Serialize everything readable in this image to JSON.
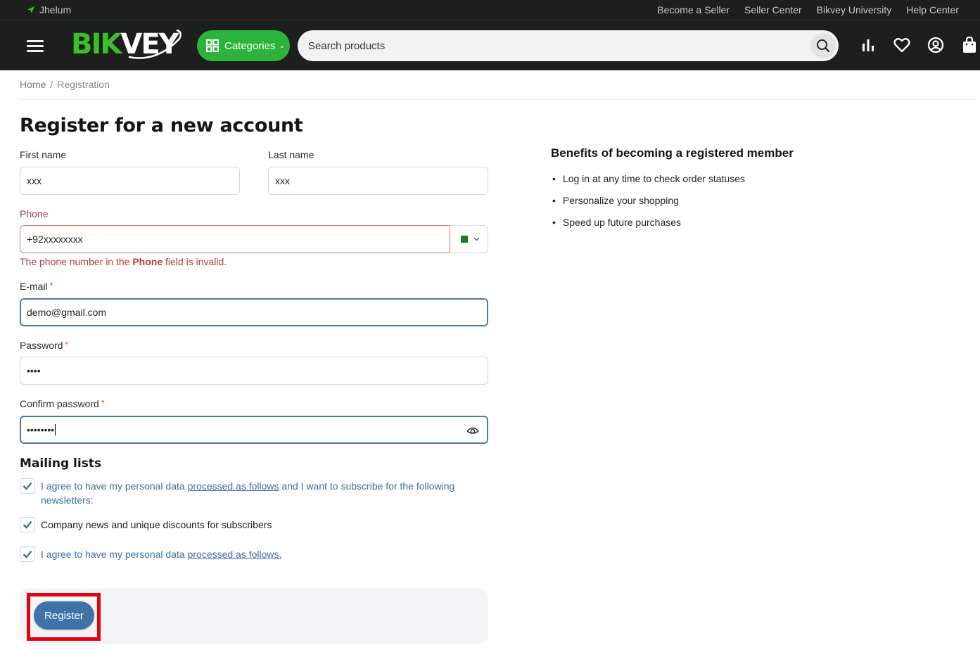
{
  "topbar": {
    "location": "Jhelum",
    "links": [
      "Become a Seller",
      "Seller Center",
      "Bikvey University",
      "Help Center"
    ]
  },
  "header": {
    "logo_part1": "BIK",
    "logo_part2": "VEY",
    "categories_label": "Categories",
    "search_placeholder": "Search products",
    "brand_green": "#2cb33c",
    "bg_color": "#1d1f1e"
  },
  "breadcrumb": {
    "home": "Home",
    "separator": "/",
    "current": "Registration"
  },
  "page_title": "Register for a new account",
  "form": {
    "first_name_label": "First name",
    "first_name_value": "xxx",
    "last_name_label": "Last name",
    "last_name_value": "xxx",
    "phone_label": "Phone",
    "phone_value": "+92xxxxxxxx",
    "phone_error_pre": "The phone number in the ",
    "phone_error_bold": "Phone",
    "phone_error_post": " field is invalid.",
    "email_label": "E-mail",
    "email_value": "demo@gmail.com",
    "password_label": "Password",
    "password_value": "••••",
    "confirm_label": "Confirm password",
    "confirm_value": "••••••••",
    "required_mark": "*"
  },
  "mailing": {
    "heading": "Mailing lists",
    "consent1_pre": "I agree to have my personal data ",
    "consent1_link": "processed as follows",
    "consent1_post": " and I want to subscribe for the following newsletters:",
    "newsletter_label": "Company news and unique discounts for subscribers",
    "consent2_pre": "I agree to have my personal data ",
    "consent2_link": "processed as follows."
  },
  "register_button": "Register",
  "benefits": {
    "heading": "Benefits of becoming a registered member",
    "items": [
      "Log in at any time to check order statuses",
      "Personalize your shopping",
      "Speed up future purchases"
    ]
  }
}
